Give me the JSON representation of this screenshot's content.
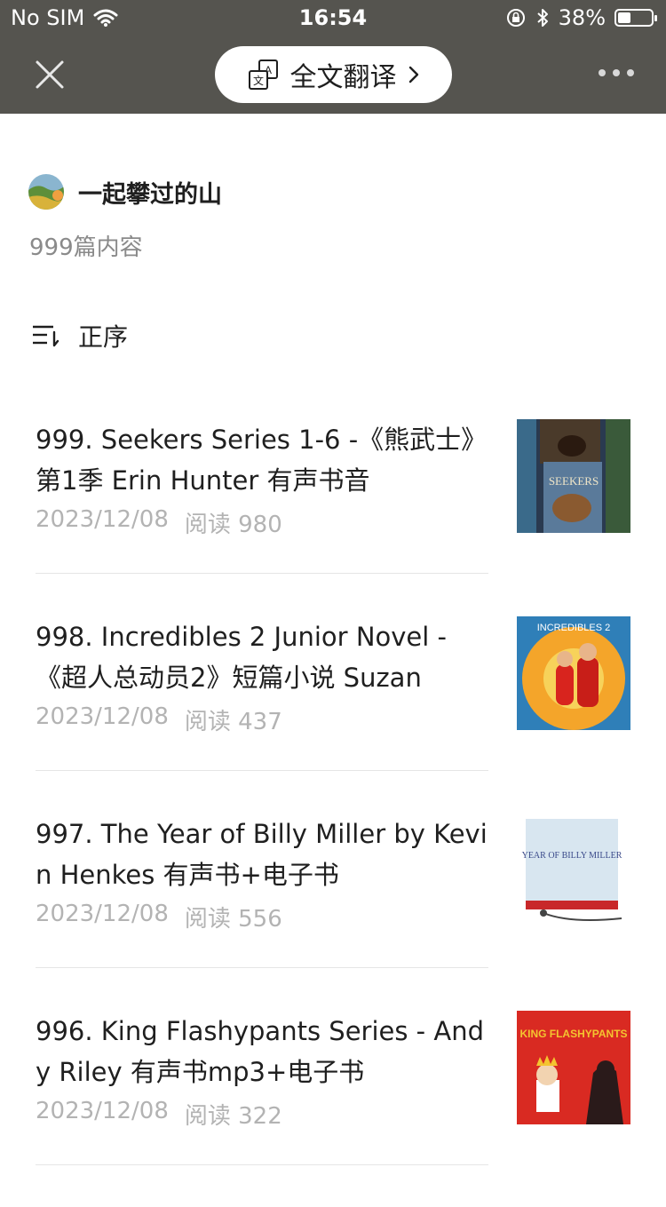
{
  "status": {
    "carrier": "No SIM",
    "time": "16:54",
    "battery": "38%",
    "battery_level": 0.38,
    "icons": [
      "wifi-icon",
      "orientation-lock-icon",
      "bluetooth-icon",
      "battery-icon"
    ]
  },
  "toolbar": {
    "translate_label": "全文翻译",
    "icons": [
      "close-icon",
      "translate-icon",
      "chevron-right-icon",
      "more-icon"
    ]
  },
  "author": {
    "name": "一起攀过的山",
    "count": "999篇内容"
  },
  "sort": {
    "label": "正序",
    "icon": "sort-icon"
  },
  "articles": [
    {
      "title": "999. Seekers Series 1-6 -《熊武士》第1季 Erin Hunter 有声书音",
      "date": "2023/12/08",
      "reads": "阅读 980",
      "thumb_text": "SEEKERS"
    },
    {
      "title": "998. Incredibles 2 Junior Novel -《超人总动员2》短篇小说 Suzan",
      "date": "2023/12/08",
      "reads": "阅读 437",
      "thumb_text": "INCREDIBLES 2"
    },
    {
      "title": "997. The Year of Billy Miller by Kevin Henkes 有声书+电子书",
      "date": "2023/12/08",
      "reads": "阅读 556",
      "thumb_text": "YEAR OF BILLY MILLER"
    },
    {
      "title": "996. King Flashypants Series - Andy Riley 有声书mp3+电子书",
      "date": "2023/12/08",
      "reads": "阅读 322",
      "thumb_text": "KING FLASHYPANTS"
    }
  ],
  "colors": {
    "toolbar_bg": "#55544f",
    "text_primary": "#1f1f1f",
    "text_meta": "#b3b3b3",
    "text_secondary": "#8a8a8a"
  }
}
